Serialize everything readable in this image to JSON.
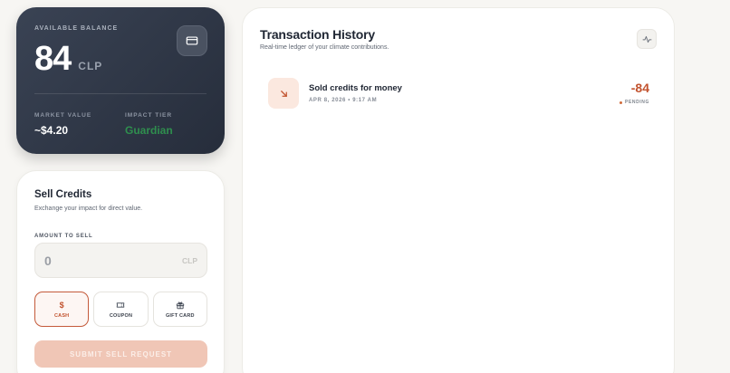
{
  "balance": {
    "label": "AVAILABLE BALANCE",
    "value": "84",
    "unit": "CLP",
    "card_icon": "credit-card-icon",
    "market_label": "MARKET VALUE",
    "market_value": "~$4.20",
    "tier_label": "IMPACT TIER",
    "tier_value": "Guardian"
  },
  "sell": {
    "title": "Sell Credits",
    "subtitle": "Exchange your impact for direct value.",
    "amount_label": "AMOUNT TO SELL",
    "amount_value": "0",
    "amount_unit": "CLP",
    "methods": [
      {
        "label": "CASH",
        "icon": "dollar-icon",
        "glyph": "$",
        "active": true
      },
      {
        "label": "COUPON",
        "icon": "ticket-icon",
        "active": false
      },
      {
        "label": "GIFT CARD",
        "icon": "gift-icon",
        "active": false
      }
    ],
    "submit_label": "SUBMIT SELL REQUEST"
  },
  "history": {
    "title": "Transaction History",
    "subtitle": "Real-time ledger of your climate contributions.",
    "activity_icon": "activity-icon",
    "transactions": [
      {
        "name": "Sold credits for money",
        "date": "APR 8, 2026 • 9:17 AM",
        "amount": "-84",
        "status": "PENDING",
        "icon": "arrow-down-right-icon"
      }
    ]
  },
  "colors": {
    "accent": "#c2532f",
    "tier": "#2f8f4e",
    "dark_card": "#2b3240"
  }
}
